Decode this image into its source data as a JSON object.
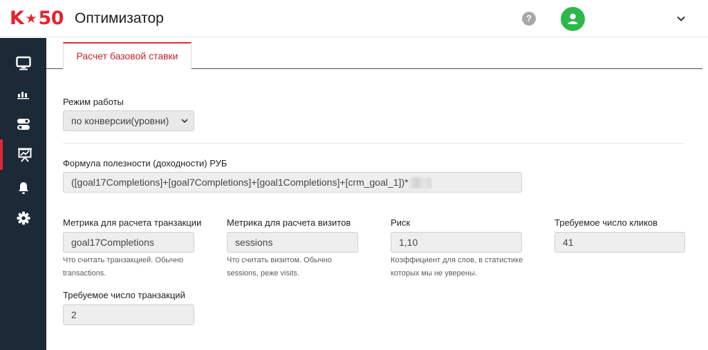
{
  "header": {
    "logo_text_left": "K",
    "logo_star": "★",
    "logo_text_right": "50",
    "app_title": "Оптимизатор",
    "help_glyph": "?"
  },
  "sidebar": {
    "items": [
      {
        "icon": "monitor-icon"
      },
      {
        "icon": "bar-chart-icon"
      },
      {
        "icon": "toggles-icon"
      },
      {
        "icon": "presentation-chart-icon",
        "active": true
      },
      {
        "icon": "bell-icon"
      },
      {
        "icon": "gear-icon"
      }
    ],
    "accent": "#e3262f",
    "background": "#1c2a38"
  },
  "tabs": [
    {
      "label": "Расчет базовой ставки",
      "active": true
    }
  ],
  "form": {
    "mode": {
      "label": "Режим работы",
      "value": "по конверсии(уровни)"
    },
    "formula": {
      "label": "Формула полезности (доходности) РУБ",
      "value": "([goal17Completions]+[goal7Completions]+[goal1Completions]+[crm_goal_1])*"
    },
    "transaction_metric": {
      "label": "Метрика для расчета транзакции",
      "value": "goal17Completions",
      "hint": "Что считать транзакцией. Обычно transactions."
    },
    "visit_metric": {
      "label": "Метрика для расчета визитов",
      "value": "sessions",
      "hint": "Что считать визитом. Обычно sessions, реже visits."
    },
    "risk": {
      "label": "Риск",
      "value": "1,10",
      "hint": "Коэффициент для слов, в статистике которых мы не уверены."
    },
    "clicks_required": {
      "label": "Требуемое число кликов",
      "value": "41"
    },
    "transactions_required": {
      "label": "Требуемое число транзакций",
      "value": "2"
    }
  },
  "colors": {
    "brand_red": "#e3262f",
    "avatar_green": "#2eb84a",
    "field_bg": "#eeeeee"
  }
}
